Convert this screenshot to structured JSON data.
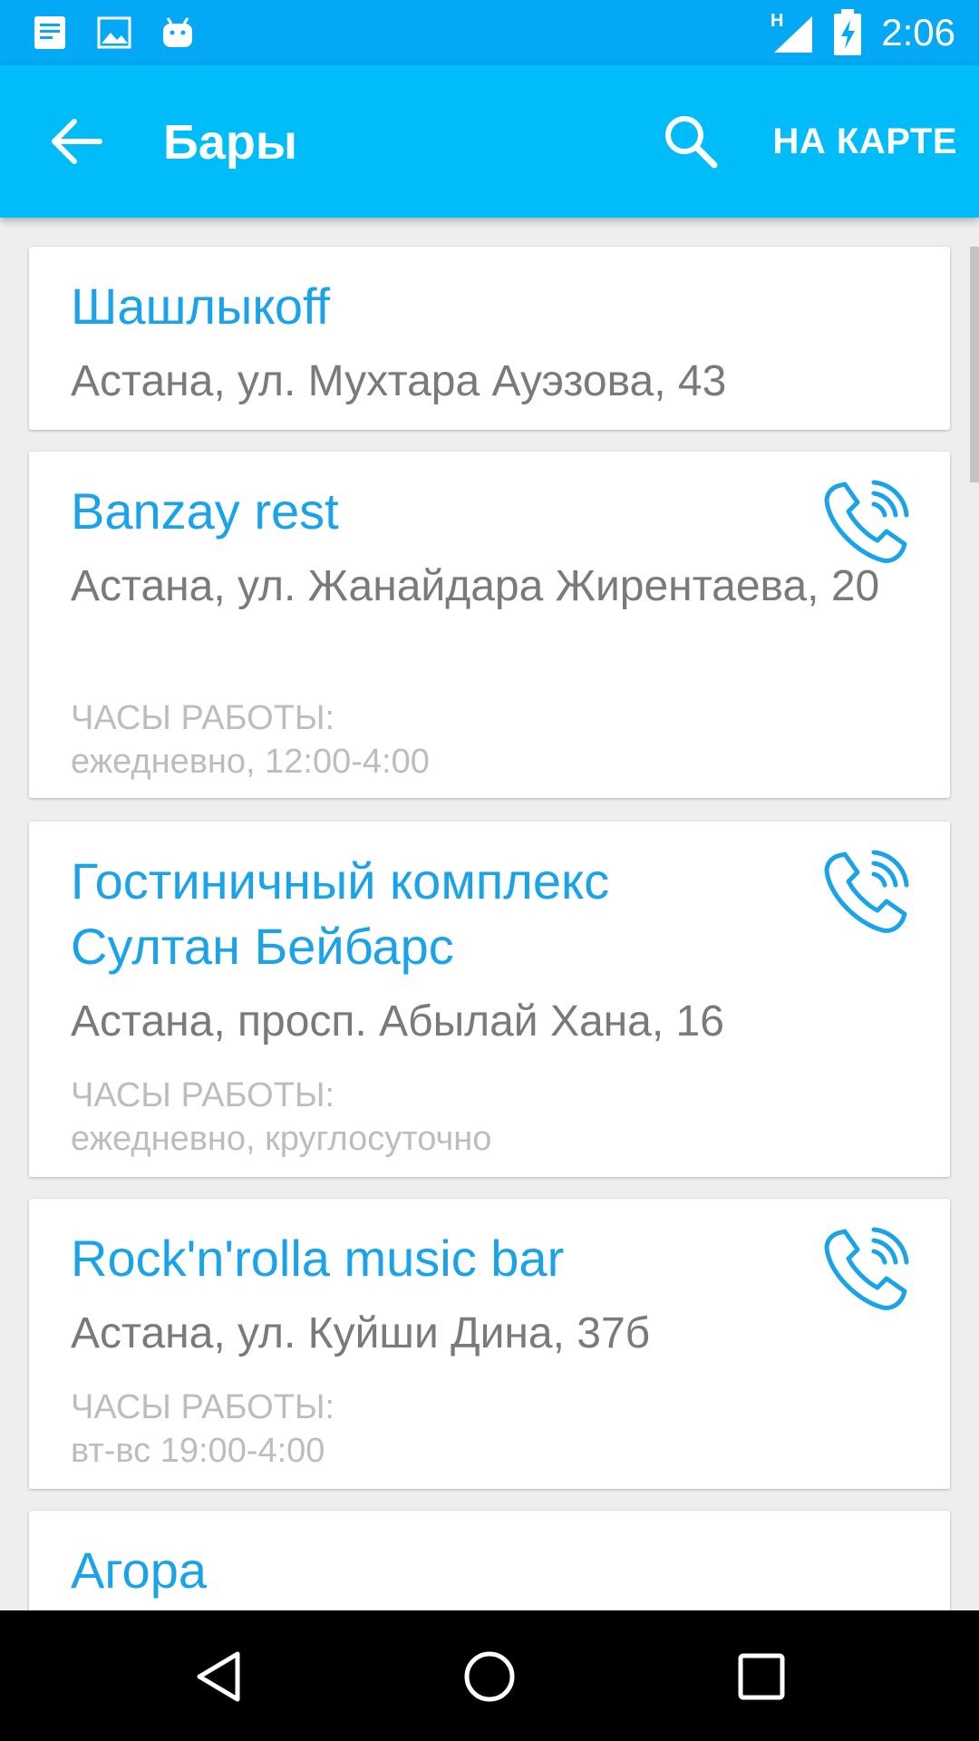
{
  "status_bar": {
    "time": "2:06",
    "network_type": "H",
    "icons": [
      "notes-icon",
      "image-icon",
      "android-icon",
      "signal-icon",
      "battery-charging-icon"
    ]
  },
  "app_bar": {
    "title": "Бары",
    "map_action": "НА КАРТЕ",
    "icons": [
      "arrow-back-icon",
      "search-icon"
    ]
  },
  "colors": {
    "status_bar": "#03a9f4",
    "app_bar": "#00bcf8",
    "accent_text": "#1aa3e8",
    "address_text": "#7a7a7a",
    "hours_text": "#bdbdbd",
    "background": "#eeeeee"
  },
  "places": [
    {
      "name": "Шашлыкoff",
      "address": "Астана, ул. Мухтара Ауэзова, 43",
      "has_phone": false
    },
    {
      "name": "Banzay rest",
      "address": "Астана, ул. Жанайдара Жирентаева, 20",
      "hours_label": "ЧАСЫ РАБОТЫ:",
      "hours": "ежедневно, 12:00-4:00",
      "has_phone": true
    },
    {
      "name": "Гостиничный комплекс Султан Бейбарс",
      "address": "Астана, просп. Абылай Хана, 16",
      "hours_label": "ЧАСЫ РАБОТЫ:",
      "hours": "ежедневно, круглосуточно",
      "has_phone": true
    },
    {
      "name": "Rock'n'rolla music bar",
      "address": "Астана, ул. Куйши Дина, 37б",
      "hours_label": "ЧАСЫ РАБОТЫ:",
      "hours": "вт-вс 19:00-4:00",
      "has_phone": true
    },
    {
      "name": "Агора",
      "has_phone": false
    }
  ],
  "nav_bar": {
    "icons": [
      "back-triangle-icon",
      "home-circle-icon",
      "recents-square-icon"
    ]
  }
}
